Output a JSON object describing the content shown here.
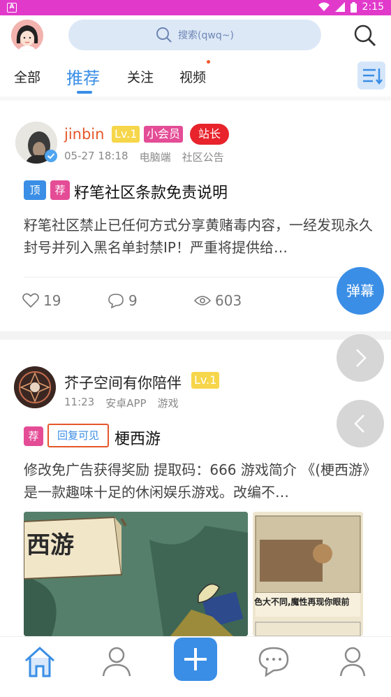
{
  "status_bar": {
    "app_icon": "A",
    "time": "2:15"
  },
  "search": {
    "placeholder": "搜索(qwq~)"
  },
  "tabs": [
    {
      "label": "全部"
    },
    {
      "label": "推荐",
      "active": true
    },
    {
      "label": "关注"
    },
    {
      "label": "视频"
    }
  ],
  "posts": [
    {
      "author": "jinbin",
      "level": "Lv.1",
      "badge_member": "小会员",
      "badge_role": "站长",
      "time": "05-27 18:18",
      "device": "电脑端",
      "category": "社区公告",
      "tags": [
        "顶",
        "荐"
      ],
      "title": "籽笔社区条款免责说明",
      "body": "籽笔社区禁止已任何方式分享黄赌毒内容，一经发现永久封号并列入黑名单封禁IP！严重将提供给…",
      "likes": "19",
      "comments": "9",
      "views": "603"
    },
    {
      "author": "芥子空间有你陪伴",
      "level": "Lv.1",
      "time": "11:23",
      "device": "安卓APP",
      "category": "游戏",
      "tags": [
        "荐",
        "回复可见"
      ],
      "title": "梗西游",
      "body": "修改免广告获得奖励 提取码：666 游戏简介 《(梗西游》是一款趣味十足的休闲娱乐游戏。改编不…",
      "image1_text": "西游",
      "image2_text": "色大不同,魔性再现你眼前"
    }
  ],
  "floating": {
    "danmu_label": "弹幕"
  },
  "colors": {
    "accent": "#3a8ee6",
    "status_bar": "#e13acb",
    "role_badge": "#e8232b",
    "member_badge": "#e44c96",
    "level_badge": "#f6d64a"
  }
}
